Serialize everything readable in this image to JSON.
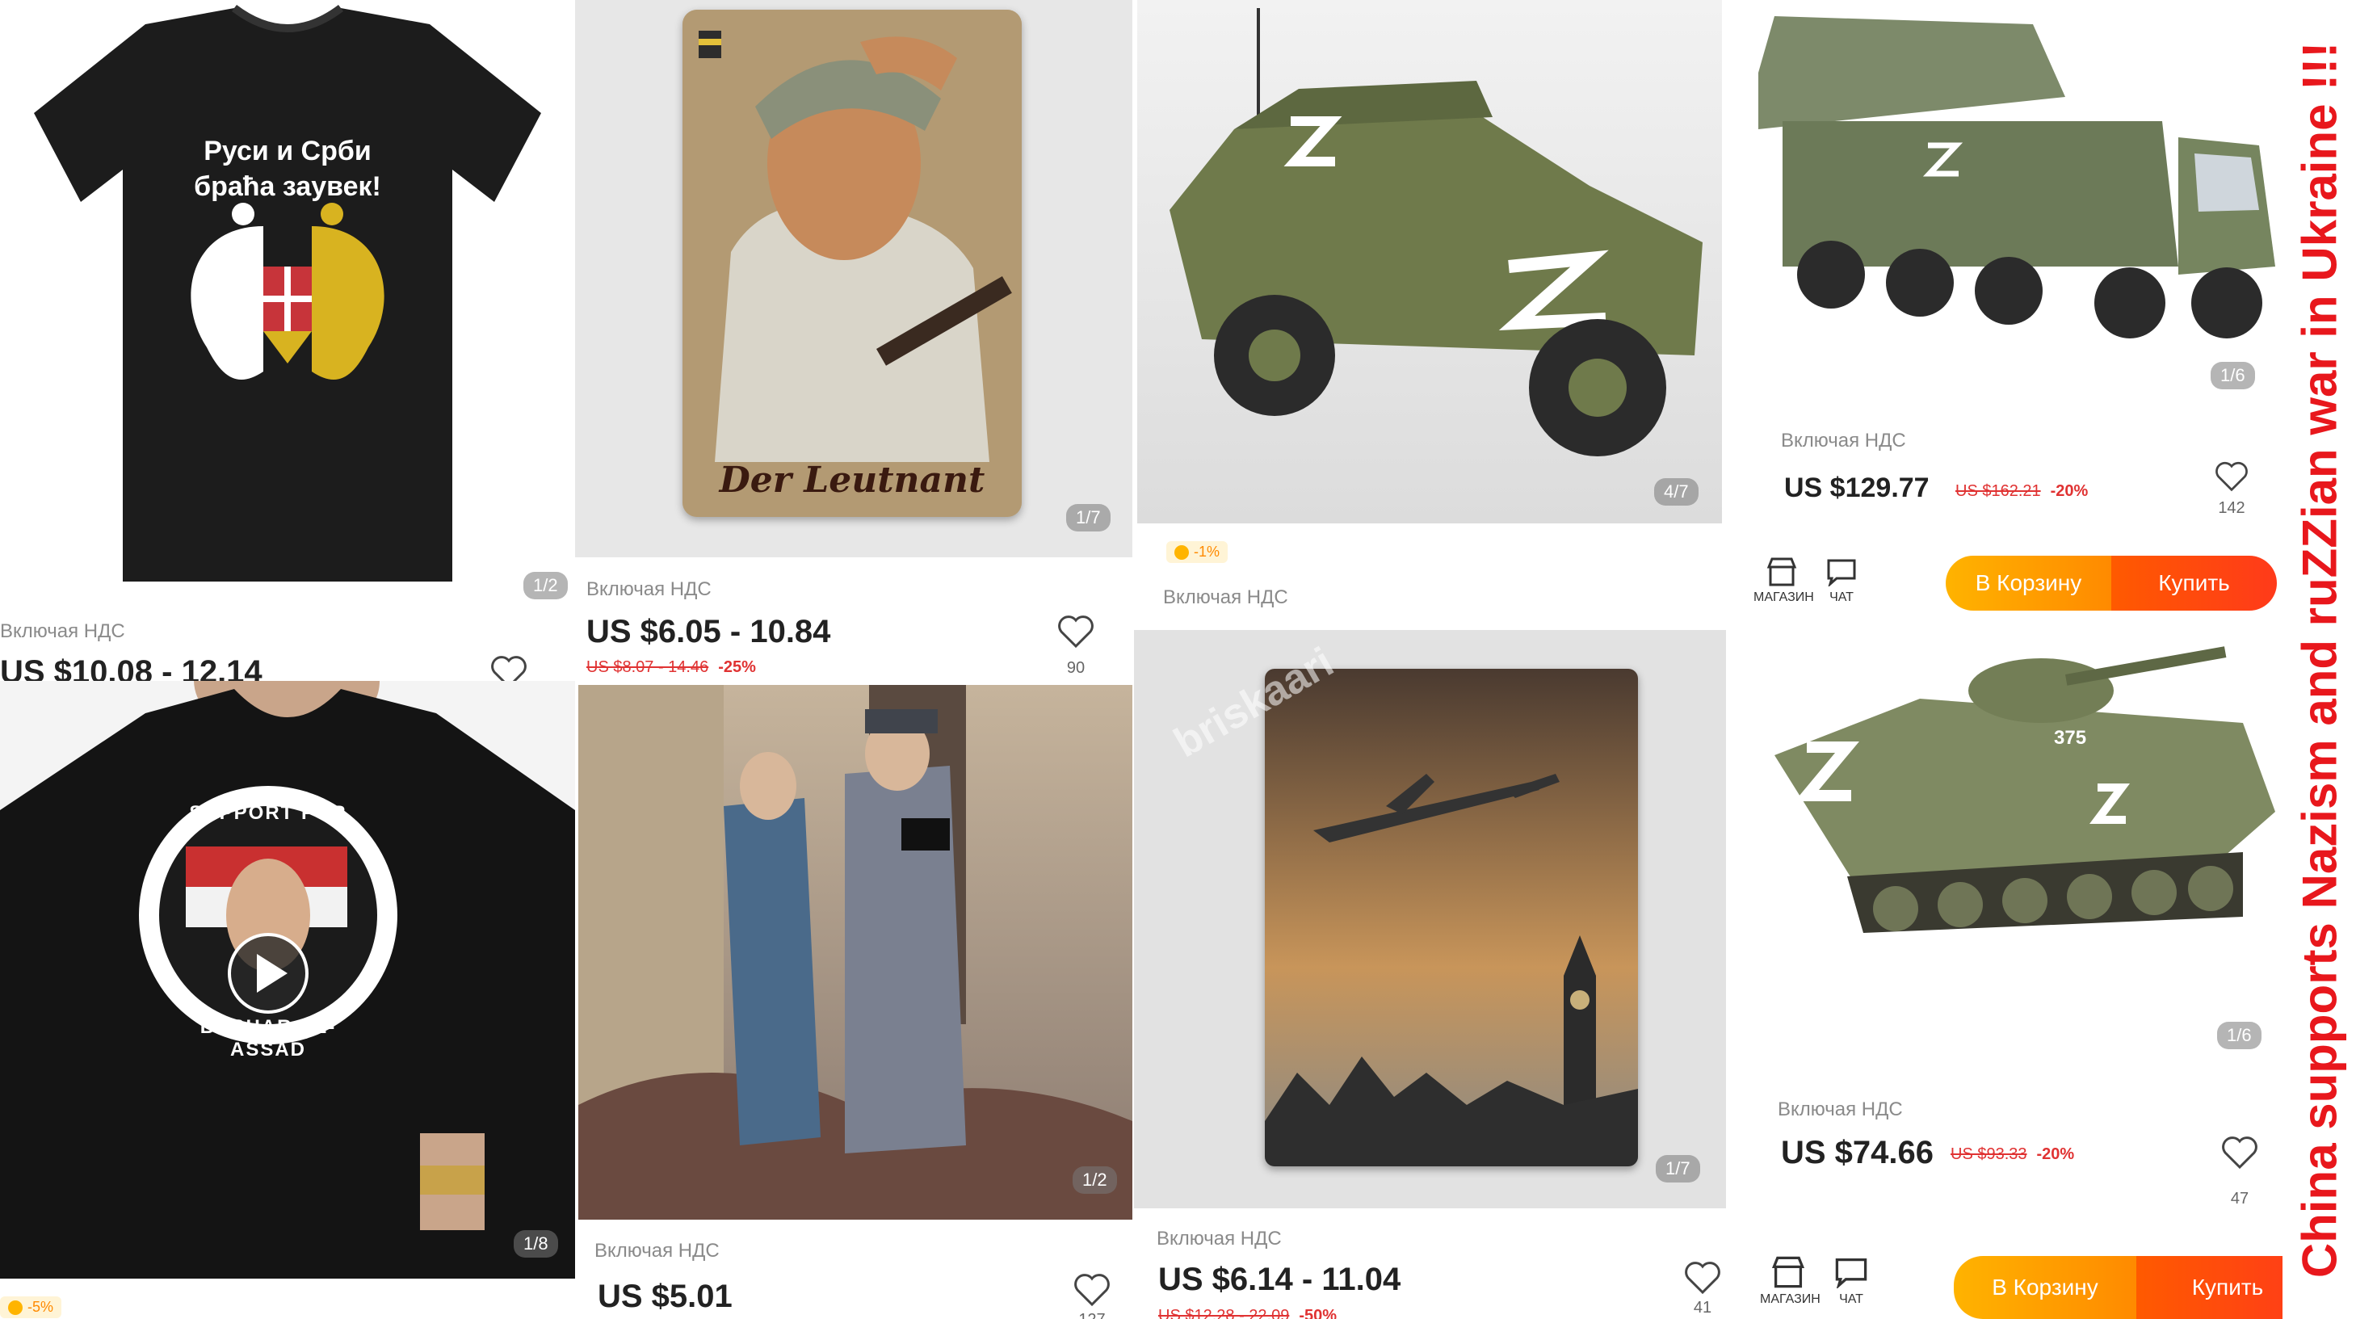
{
  "cells": [
    {
      "id": "tshirt-russia-serbia",
      "shirt_line1": "Руси и Срби",
      "shirt_line2": "браћа заувек!",
      "counter": "1/2",
      "vat": "Включая НДС",
      "price": "US $10.08 - 12.14"
    },
    {
      "id": "der-leutnant-poster",
      "poster_title": "Der Leutnant",
      "counter": "1/7",
      "vat": "Включая НДС",
      "price": "US $6.05 - 10.84",
      "old_price": "US $8.07 - 14.46",
      "discount": "-25%",
      "likes": "90"
    },
    {
      "id": "z-military-vehicle-model",
      "counter": "4/7",
      "promo": "-1%",
      "vat": "Включая НДС"
    },
    {
      "id": "pantsir-truck-model",
      "counter": "1/6",
      "vat": "Включая НДС",
      "price": "US $129.77",
      "old_price": "US $162.21",
      "discount": "-20%",
      "likes": "142",
      "store_label": "МАГАЗИН",
      "chat_label": "ЧАТ",
      "cart_label": "В Корзину",
      "buy_label": "Купить"
    },
    {
      "id": "tshirt-assad",
      "badge_top": "SUPPORT FOR",
      "badge_bottom": "BASHAR AL-ASSAD",
      "counter": "1/8",
      "promo": "-5%"
    },
    {
      "id": "handshake-figure",
      "counter": "1/2",
      "vat": "Включая НДС",
      "price": "US $5.01",
      "likes": "127"
    },
    {
      "id": "v1-over-london-sign",
      "watermark": "briskaari",
      "counter": "1/7",
      "vat": "Включая НДС",
      "price": "US $6.14 - 11.04",
      "old_price": "US $12.28 - 22.09",
      "discount": "-50%",
      "likes": "41"
    },
    {
      "id": "bmp-z-model",
      "hull_number": "375",
      "counter": "1/6",
      "vat": "Включая НДС",
      "price": "US $74.66",
      "old_price": "US $93.33",
      "discount": "-20%",
      "likes": "47",
      "store_label": "МАГАЗИН",
      "chat_label": "ЧАТ",
      "cart_label": "В Корзину",
      "buy_label": "Купить"
    }
  ],
  "banner": "China supports Nazism and ruZZian war in Ukraine !!!",
  "colors": {
    "price_red": "#e03232",
    "cart_orange": "#ff9a00",
    "buy_orange": "#ff4a10",
    "banner_red": "#e8171c"
  }
}
